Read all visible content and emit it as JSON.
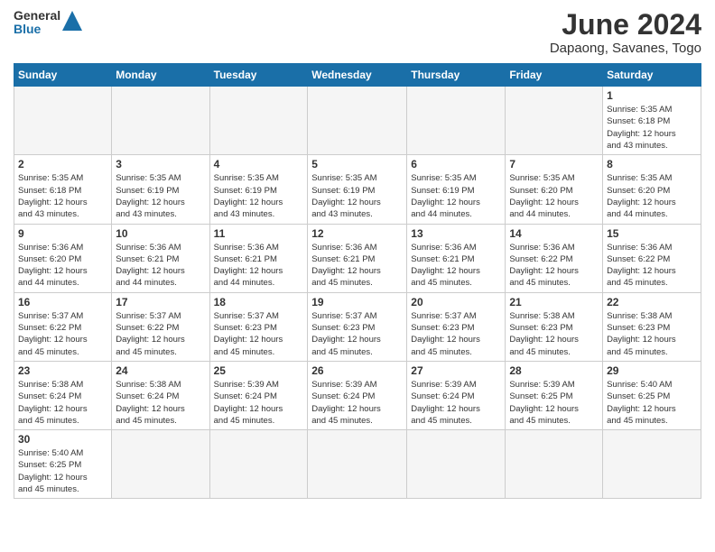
{
  "header": {
    "logo_general": "General",
    "logo_blue": "Blue",
    "month_title": "June 2024",
    "location": "Dapaong, Savanes, Togo"
  },
  "days_of_week": [
    "Sunday",
    "Monday",
    "Tuesday",
    "Wednesday",
    "Thursday",
    "Friday",
    "Saturday"
  ],
  "weeks": [
    [
      {
        "day": "",
        "info": ""
      },
      {
        "day": "",
        "info": ""
      },
      {
        "day": "",
        "info": ""
      },
      {
        "day": "",
        "info": ""
      },
      {
        "day": "",
        "info": ""
      },
      {
        "day": "",
        "info": ""
      },
      {
        "day": "1",
        "info": "Sunrise: 5:35 AM\nSunset: 6:18 PM\nDaylight: 12 hours\nand 43 minutes."
      }
    ],
    [
      {
        "day": "2",
        "info": "Sunrise: 5:35 AM\nSunset: 6:18 PM\nDaylight: 12 hours\nand 43 minutes."
      },
      {
        "day": "3",
        "info": "Sunrise: 5:35 AM\nSunset: 6:19 PM\nDaylight: 12 hours\nand 43 minutes."
      },
      {
        "day": "4",
        "info": "Sunrise: 5:35 AM\nSunset: 6:19 PM\nDaylight: 12 hours\nand 43 minutes."
      },
      {
        "day": "5",
        "info": "Sunrise: 5:35 AM\nSunset: 6:19 PM\nDaylight: 12 hours\nand 43 minutes."
      },
      {
        "day": "6",
        "info": "Sunrise: 5:35 AM\nSunset: 6:19 PM\nDaylight: 12 hours\nand 44 minutes."
      },
      {
        "day": "7",
        "info": "Sunrise: 5:35 AM\nSunset: 6:20 PM\nDaylight: 12 hours\nand 44 minutes."
      },
      {
        "day": "8",
        "info": "Sunrise: 5:35 AM\nSunset: 6:20 PM\nDaylight: 12 hours\nand 44 minutes."
      }
    ],
    [
      {
        "day": "9",
        "info": "Sunrise: 5:36 AM\nSunset: 6:20 PM\nDaylight: 12 hours\nand 44 minutes."
      },
      {
        "day": "10",
        "info": "Sunrise: 5:36 AM\nSunset: 6:21 PM\nDaylight: 12 hours\nand 44 minutes."
      },
      {
        "day": "11",
        "info": "Sunrise: 5:36 AM\nSunset: 6:21 PM\nDaylight: 12 hours\nand 44 minutes."
      },
      {
        "day": "12",
        "info": "Sunrise: 5:36 AM\nSunset: 6:21 PM\nDaylight: 12 hours\nand 45 minutes."
      },
      {
        "day": "13",
        "info": "Sunrise: 5:36 AM\nSunset: 6:21 PM\nDaylight: 12 hours\nand 45 minutes."
      },
      {
        "day": "14",
        "info": "Sunrise: 5:36 AM\nSunset: 6:22 PM\nDaylight: 12 hours\nand 45 minutes."
      },
      {
        "day": "15",
        "info": "Sunrise: 5:36 AM\nSunset: 6:22 PM\nDaylight: 12 hours\nand 45 minutes."
      }
    ],
    [
      {
        "day": "16",
        "info": "Sunrise: 5:37 AM\nSunset: 6:22 PM\nDaylight: 12 hours\nand 45 minutes."
      },
      {
        "day": "17",
        "info": "Sunrise: 5:37 AM\nSunset: 6:22 PM\nDaylight: 12 hours\nand 45 minutes."
      },
      {
        "day": "18",
        "info": "Sunrise: 5:37 AM\nSunset: 6:23 PM\nDaylight: 12 hours\nand 45 minutes."
      },
      {
        "day": "19",
        "info": "Sunrise: 5:37 AM\nSunset: 6:23 PM\nDaylight: 12 hours\nand 45 minutes."
      },
      {
        "day": "20",
        "info": "Sunrise: 5:37 AM\nSunset: 6:23 PM\nDaylight: 12 hours\nand 45 minutes."
      },
      {
        "day": "21",
        "info": "Sunrise: 5:38 AM\nSunset: 6:23 PM\nDaylight: 12 hours\nand 45 minutes."
      },
      {
        "day": "22",
        "info": "Sunrise: 5:38 AM\nSunset: 6:23 PM\nDaylight: 12 hours\nand 45 minutes."
      }
    ],
    [
      {
        "day": "23",
        "info": "Sunrise: 5:38 AM\nSunset: 6:24 PM\nDaylight: 12 hours\nand 45 minutes."
      },
      {
        "day": "24",
        "info": "Sunrise: 5:38 AM\nSunset: 6:24 PM\nDaylight: 12 hours\nand 45 minutes."
      },
      {
        "day": "25",
        "info": "Sunrise: 5:39 AM\nSunset: 6:24 PM\nDaylight: 12 hours\nand 45 minutes."
      },
      {
        "day": "26",
        "info": "Sunrise: 5:39 AM\nSunset: 6:24 PM\nDaylight: 12 hours\nand 45 minutes."
      },
      {
        "day": "27",
        "info": "Sunrise: 5:39 AM\nSunset: 6:24 PM\nDaylight: 12 hours\nand 45 minutes."
      },
      {
        "day": "28",
        "info": "Sunrise: 5:39 AM\nSunset: 6:25 PM\nDaylight: 12 hours\nand 45 minutes."
      },
      {
        "day": "29",
        "info": "Sunrise: 5:40 AM\nSunset: 6:25 PM\nDaylight: 12 hours\nand 45 minutes."
      }
    ],
    [
      {
        "day": "30",
        "info": "Sunrise: 5:40 AM\nSunset: 6:25 PM\nDaylight: 12 hours\nand 45 minutes."
      },
      {
        "day": "",
        "info": ""
      },
      {
        "day": "",
        "info": ""
      },
      {
        "day": "",
        "info": ""
      },
      {
        "day": "",
        "info": ""
      },
      {
        "day": "",
        "info": ""
      },
      {
        "day": "",
        "info": ""
      }
    ]
  ]
}
